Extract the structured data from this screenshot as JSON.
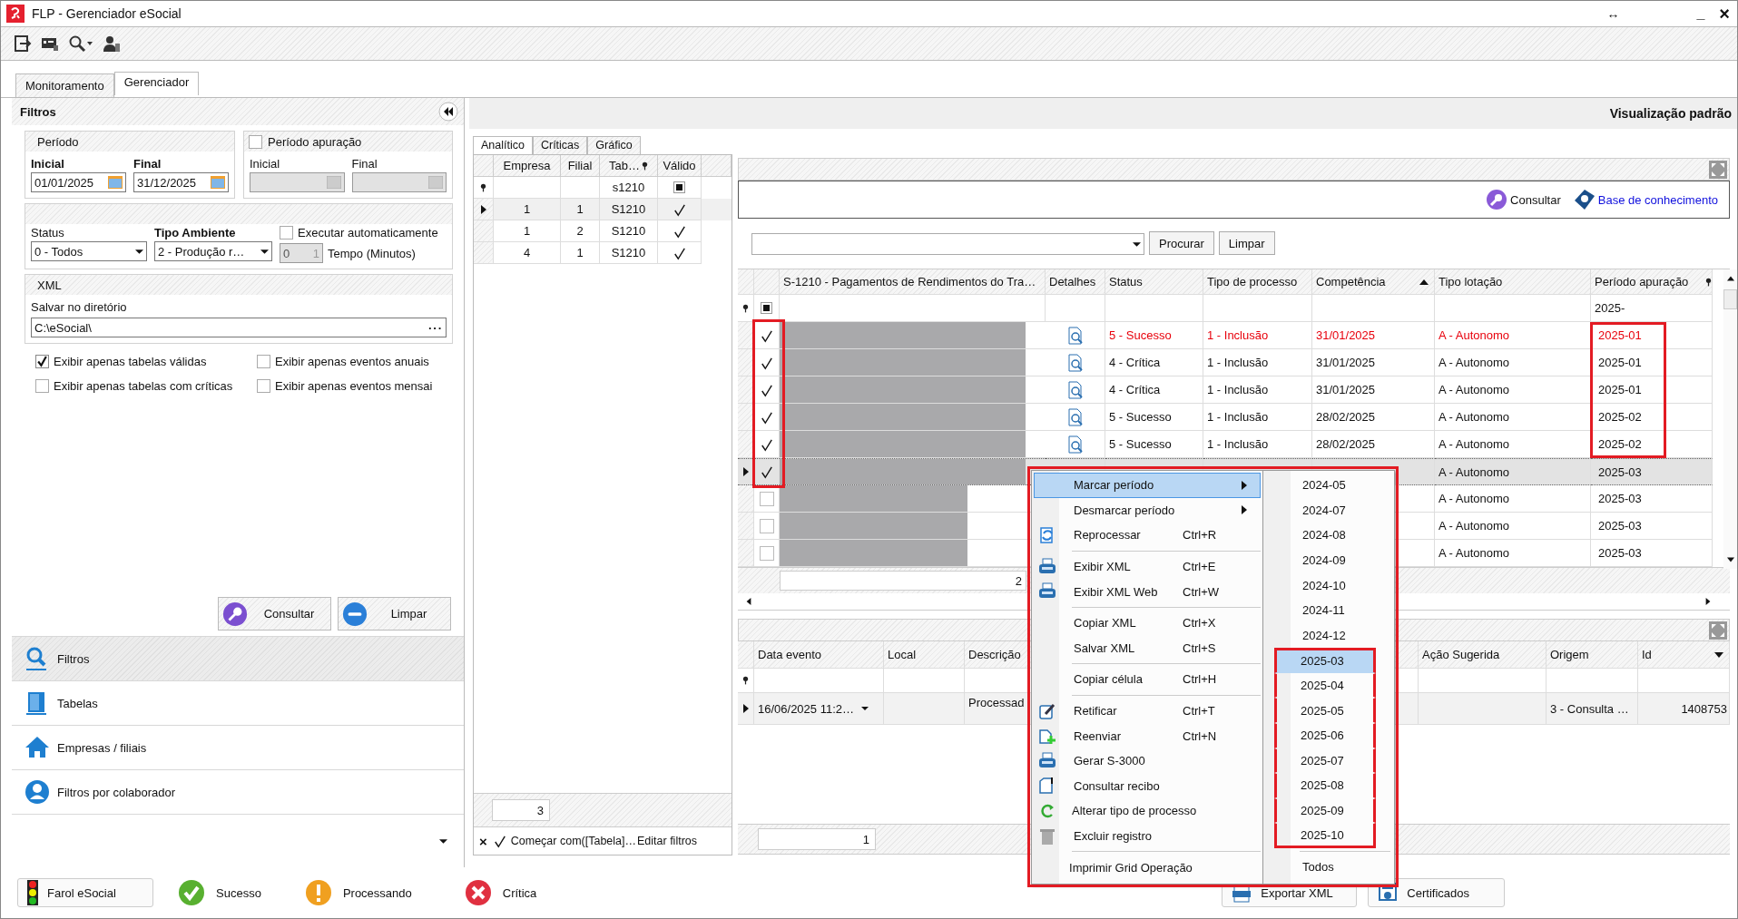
{
  "window": {
    "title": "FLP - Gerenciador eSocial",
    "controls": [
      "↔",
      "_",
      "×"
    ]
  },
  "main_tabs": [
    {
      "label": "Monitoramento",
      "selected": false
    },
    {
      "label": "Gerenciador",
      "selected": true
    }
  ],
  "filters": {
    "title": "Filtros",
    "periodo": {
      "title": "Período",
      "inicial_label": "Inicial",
      "inicial_value": "01/01/2025",
      "final_label": "Final",
      "final_value": "31/12/2025"
    },
    "periodo_apuracao": {
      "label": "Período apuração",
      "checked": false,
      "inicial_label": "Inicial",
      "final_label": "Final"
    },
    "status": {
      "label": "Status",
      "value": "0 - Todos"
    },
    "tipo_ambiente": {
      "label": "Tipo Ambiente",
      "value": "2 - Produção r…"
    },
    "executar": {
      "label": "Executar automaticamente",
      "checked": false
    },
    "tempo": {
      "value": "0",
      "step": "1",
      "label": "Tempo (Minutos)"
    },
    "xml": {
      "title": "XML",
      "dir_label": "Salvar no diretório",
      "dir_value": "C:\\eSocial\\",
      "browse": "···"
    },
    "options": [
      {
        "label": "Exibir apenas tabelas válidas",
        "checked": true
      },
      {
        "label": "Exibir apenas eventos anuais",
        "checked": false
      },
      {
        "label": "Exibir apenas tabelas com críticas",
        "checked": false
      },
      {
        "label": "Exibir apenas eventos mensai",
        "checked": false
      }
    ],
    "buttons": [
      {
        "label": "Consultar",
        "kind": "consultar"
      },
      {
        "label": "Limpar",
        "kind": "limpar"
      }
    ]
  },
  "nav": [
    {
      "label": "Filtros",
      "kind": "search",
      "selected": true
    },
    {
      "label": "Tabelas",
      "kind": "book",
      "selected": false
    },
    {
      "label": "Empresas / filiais",
      "kind": "home",
      "selected": false
    },
    {
      "label": "Filtros por colaborador",
      "kind": "user",
      "selected": false
    }
  ],
  "view_title": "Visualização padrão",
  "table_tabs": [
    {
      "label": "Analítico",
      "selected": true
    },
    {
      "label": "Críticas",
      "selected": false
    },
    {
      "label": "Gráfico",
      "selected": false
    }
  ],
  "tables_grid": {
    "columns": [
      "Empresa",
      "Filial",
      "Tab…",
      "Válido"
    ],
    "filter_tabela": "s1210",
    "filter_valido_on": true,
    "rows": [
      {
        "empresa": "1",
        "filial": "1",
        "tabela": "S1210",
        "valido": true,
        "selected": true
      },
      {
        "empresa": "1",
        "filial": "2",
        "tabela": "S1210",
        "valido": true,
        "selected": false
      },
      {
        "empresa": "4",
        "filial": "1",
        "tabela": "S1210",
        "valido": true,
        "selected": false
      }
    ],
    "count": "3",
    "clear_filter": "×",
    "filter_checked": true,
    "filter_text": "Começar com([Tabela]…",
    "edit_filters": "Editar filtros"
  },
  "events": {
    "consultar": "Consultar",
    "kb_link": "Base de conhecimento",
    "search_button": "Procurar",
    "clear_button": "Limpar",
    "columns": [
      "S-1210 - Pagamentos de Rendimentos do Tra…",
      "Detalhes",
      "Status",
      "Tipo de processo",
      "Competência",
      "Tipo lotação",
      "Período apuração"
    ],
    "filter_check_on": true,
    "filter_periodo": "2025-",
    "rows": [
      {
        "checked": true,
        "selected": false,
        "highlighted": true,
        "kind": "wide",
        "details": true,
        "status": "5 - Sucesso",
        "tipo": "1 - Inclusão",
        "competencia": "31/01/2025",
        "lotacao": "A - Autonomo",
        "periodo": "2025-01"
      },
      {
        "checked": true,
        "selected": false,
        "highlighted": false,
        "kind": "wide",
        "details": true,
        "status": "4 - Crítica",
        "tipo": "1 - Inclusão",
        "competencia": "31/01/2025",
        "lotacao": "A - Autonomo",
        "periodo": "2025-01"
      },
      {
        "checked": true,
        "selected": false,
        "highlighted": false,
        "kind": "wide",
        "details": true,
        "status": "4 - Crítica",
        "tipo": "1 - Inclusão",
        "competencia": "31/01/2025",
        "lotacao": "A - Autonomo",
        "periodo": "2025-01"
      },
      {
        "checked": true,
        "selected": false,
        "highlighted": false,
        "kind": "wide",
        "details": true,
        "status": "5 - Sucesso",
        "tipo": "1 - Inclusão",
        "competencia": "28/02/2025",
        "lotacao": "A - Autonomo",
        "periodo": "2025-02"
      },
      {
        "checked": true,
        "selected": false,
        "highlighted": false,
        "kind": "wide",
        "details": true,
        "status": "5 - Sucesso",
        "tipo": "1 - Inclusão",
        "competencia": "28/02/2025",
        "lotacao": "A - Autonomo",
        "periodo": "2025-02"
      },
      {
        "checked": true,
        "selected": true,
        "highlighted": false,
        "kind": "wide",
        "lotacao": "A - Autonomo",
        "periodo": "2025-03"
      },
      {
        "checked": false,
        "selected": false,
        "highlighted": false,
        "kind": "narrow",
        "lotacao": "A - Autonomo",
        "periodo": "2025-03"
      },
      {
        "checked": false,
        "selected": false,
        "highlighted": false,
        "kind": "narrow",
        "lotacao": "A - Autonomo",
        "periodo": "2025-03"
      },
      {
        "checked": false,
        "selected": false,
        "highlighted": false,
        "kind": "narrow",
        "lotacao": "A - Autonomo",
        "periodo": "2025-03"
      }
    ],
    "footer": "2"
  },
  "log": {
    "columns": [
      "Data evento",
      "Local",
      "Descrição",
      "Ação Sugerida",
      "Origem",
      "Id"
    ],
    "rows": [
      {
        "data": "16/06/2025 11:2…",
        "descricao": "Processad",
        "origem": "3 - Consulta …",
        "id": "1408753"
      }
    ],
    "count": "1"
  },
  "context_menu": {
    "groups": [
      [
        {
          "label": "Marcar período",
          "kind": "none",
          "submenu": true,
          "selected": true
        },
        {
          "label": "Desmarcar período",
          "kind": "none",
          "submenu": true,
          "selected": false
        },
        {
          "label": "Reprocessar",
          "shortcut": "Ctrl+R",
          "kind": "reprocess",
          "submenu": false,
          "selected": false
        }
      ],
      [
        {
          "label": "Exibir XML",
          "shortcut": "Ctrl+E",
          "kind": "xml",
          "submenu": false,
          "selected": false
        },
        {
          "label": "Exibir XML Web",
          "shortcut": "Ctrl+W",
          "kind": "xml",
          "submenu": false,
          "selected": false
        }
      ],
      [
        {
          "label": "Copiar XML",
          "shortcut": "Ctrl+X",
          "kind": "none",
          "submenu": false,
          "selected": false
        },
        {
          "label": "Salvar XML",
          "shortcut": "Ctrl+S",
          "kind": "none",
          "submenu": false,
          "selected": false
        }
      ],
      [
        {
          "label": "Copiar célula",
          "shortcut": "Ctrl+H",
          "kind": "none",
          "submenu": false,
          "selected": false
        }
      ],
      [
        {
          "label": "Retificar",
          "shortcut": "Ctrl+T",
          "kind": "edit",
          "submenu": false,
          "selected": false
        },
        {
          "label": "Reenviar",
          "shortcut": "Ctrl+N",
          "kind": "add",
          "submenu": false,
          "selected": false
        },
        {
          "label": "Gerar S-3000",
          "kind": "printer",
          "submenu": false,
          "selected": false
        },
        {
          "label": "Consultar recibo",
          "kind": "receipt",
          "submenu": false,
          "selected": false
        },
        {
          "label": "Alterar tipo de processo",
          "kind": "refresh",
          "submenu": false,
          "selected": false
        },
        {
          "label": "Excluir registro",
          "kind": "trash",
          "submenu": false,
          "selected": false
        }
      ],
      [
        {
          "label": "Imprimir Grid Operação",
          "kind": "none",
          "submenu": false,
          "selected": false
        }
      ]
    ]
  },
  "period_submenu": {
    "groups": [
      [
        {
          "label": "2024-05",
          "selected": false,
          "annotated": false
        },
        {
          "label": "2024-07",
          "selected": false,
          "annotated": false
        },
        {
          "label": "2024-08",
          "selected": false,
          "annotated": false
        },
        {
          "label": "2024-09",
          "selected": false,
          "annotated": false
        },
        {
          "label": "2024-10",
          "selected": false,
          "annotated": false
        },
        {
          "label": "2024-11",
          "selected": false,
          "annotated": false
        },
        {
          "label": "2024-12",
          "selected": false,
          "annotated": false
        },
        {
          "label": "2025-03",
          "selected": true,
          "annotated": true
        },
        {
          "label": "2025-04",
          "selected": false,
          "annotated": true
        },
        {
          "label": "2025-05",
          "selected": false,
          "annotated": true
        },
        {
          "label": "2025-06",
          "selected": false,
          "annotated": true
        },
        {
          "label": "2025-07",
          "selected": false,
          "annotated": true
        },
        {
          "label": "2025-08",
          "selected": false,
          "annotated": true
        },
        {
          "label": "2025-09",
          "selected": false,
          "annotated": true
        },
        {
          "label": "2025-10",
          "selected": false,
          "annotated": true
        }
      ],
      [
        {
          "label": "Todos",
          "selected": false,
          "annotated": false
        }
      ]
    ]
  },
  "legend": [
    {
      "label": "Farol eSocial",
      "kind": "farol"
    },
    {
      "label": "Sucesso",
      "kind": "sucesso"
    },
    {
      "label": "Processando",
      "kind": "processando"
    },
    {
      "label": "Crítica",
      "kind": "critica"
    },
    {
      "label": "Exportar XML",
      "kind": "exportar"
    },
    {
      "label": "Certificados",
      "kind": "certificados"
    }
  ]
}
